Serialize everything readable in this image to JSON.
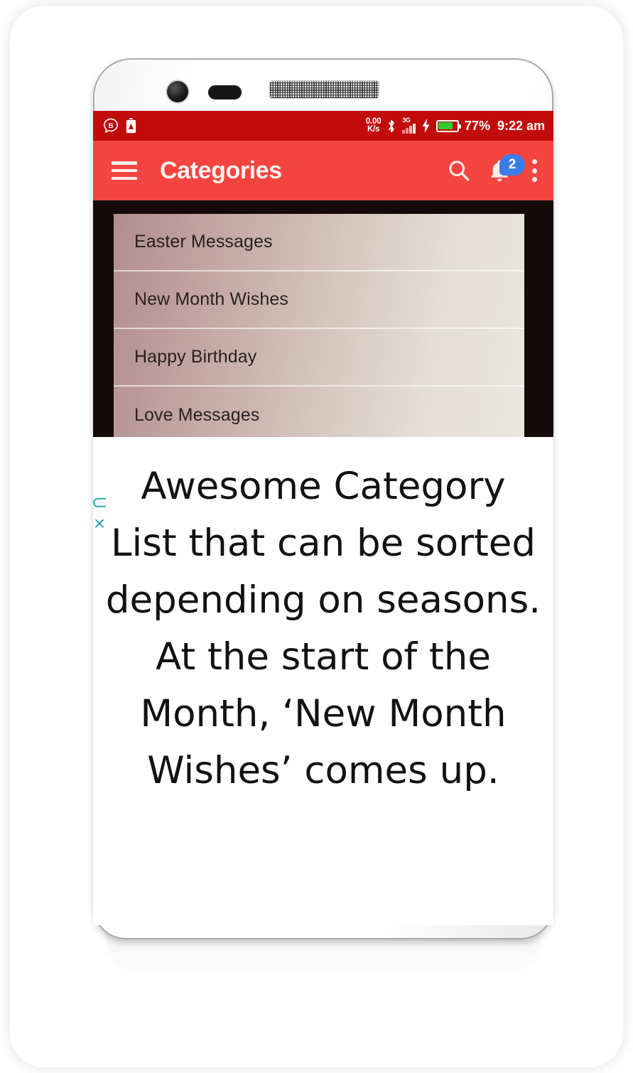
{
  "device": {
    "hardware": {
      "front_camera": "front-camera",
      "proximity_sensor": "proximity-sensor",
      "earpiece": "earpiece-speaker"
    }
  },
  "status_bar": {
    "background_color": "#c20c0c",
    "left_icons": [
      {
        "name": "bubble-b-icon",
        "label": "B"
      },
      {
        "name": "battery-alert-icon",
        "label": ""
      }
    ],
    "network_speed": {
      "value": "0.00",
      "unit": "K/s"
    },
    "bluetooth_icon": "bluetooth-icon",
    "network_type": "3G",
    "signal_bars": 4,
    "charging_icon": "charging-bolt-icon",
    "battery_percent_value": 77,
    "battery_percent": "77%",
    "battery_color": "#2ecc2e",
    "clock": "9:22 am"
  },
  "app_bar": {
    "background_color": "#f4443f",
    "menu_icon": "hamburger-menu-icon",
    "title": "Categories",
    "search_icon": "search-icon",
    "notification_icon": "notification-bell-icon",
    "notification_badge": "2",
    "badge_color": "#3b7de8",
    "overflow_icon": "overflow-menu-icon"
  },
  "screenshot": {
    "frame_color": "#150909",
    "list_gradient_from": "#b08e8e",
    "list_gradient_to": "#e9e6e0",
    "categories": [
      {
        "label": "Easter Messages"
      },
      {
        "label": "New Month Wishes"
      },
      {
        "label": "Happy Birthday"
      },
      {
        "label": "Love Messages"
      }
    ]
  },
  "caption": {
    "paragraph_1": "Awesome Category List that can be sorted depending on seasons.",
    "paragraph_2": "At the start of the Month, ‘New Month Wishes’ comes up."
  },
  "watermark": {
    "arc": "⊂",
    "cross": "×",
    "color": "#2aa6b8"
  }
}
